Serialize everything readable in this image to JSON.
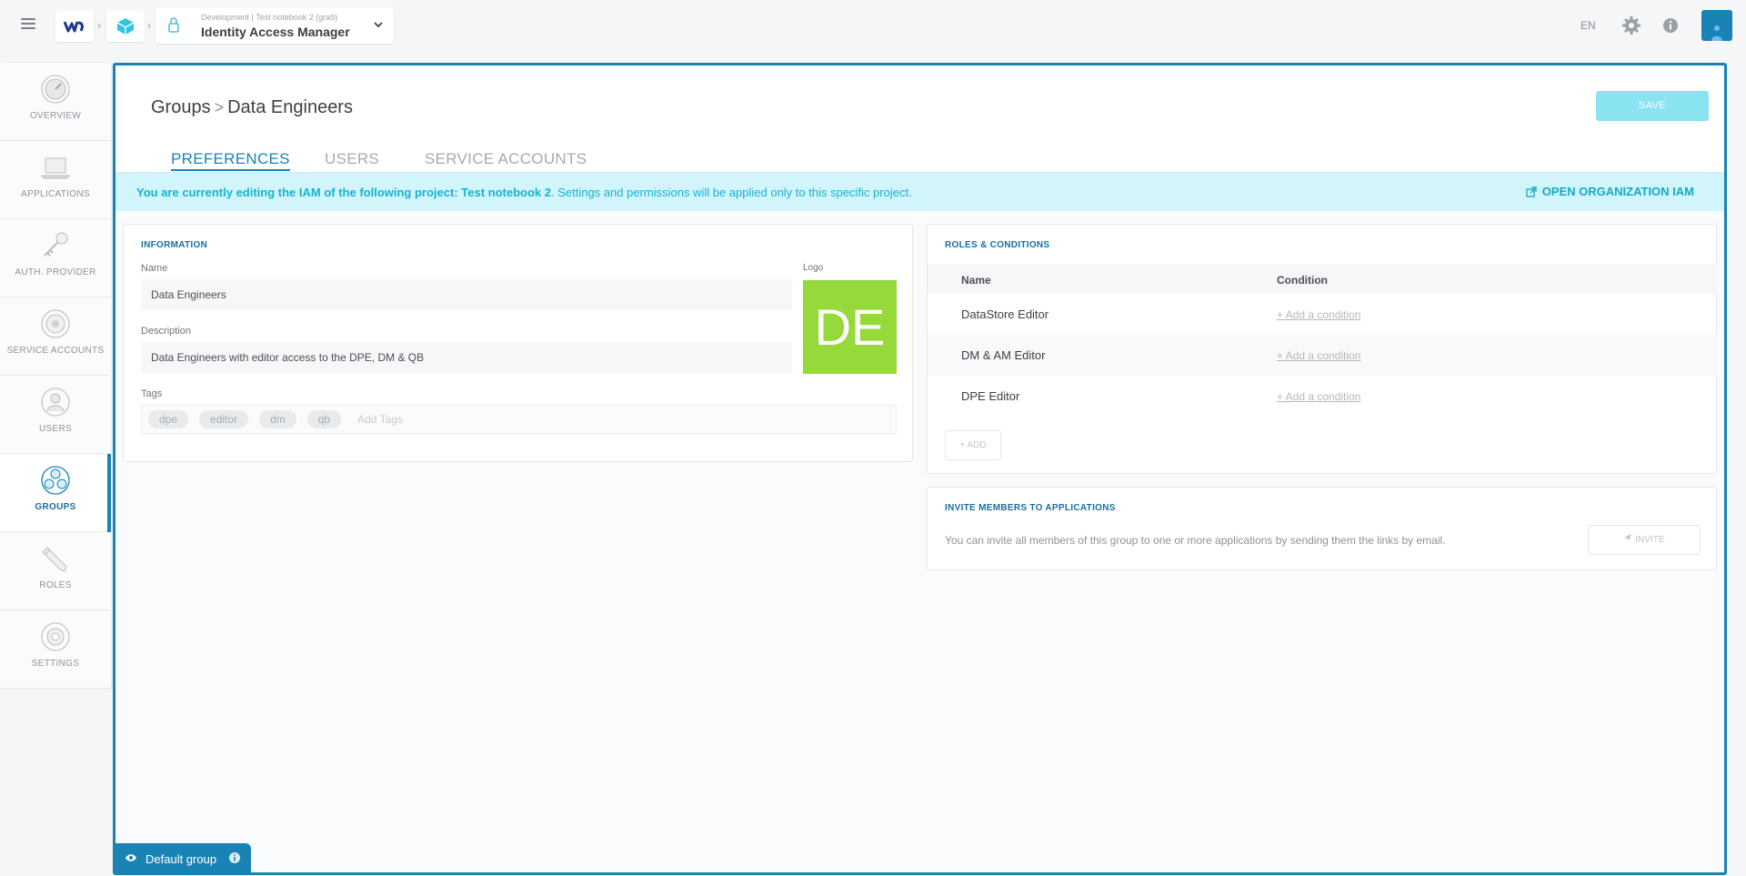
{
  "topbar": {
    "context": "Development | Test notebook 2 (gra9)",
    "app_name": "Identity Access Manager",
    "language": "EN"
  },
  "sidebar": {
    "items": [
      {
        "label": "OVERVIEW",
        "icon": "overview-icon"
      },
      {
        "label": "APPLICATIONS",
        "icon": "laptop-icon"
      },
      {
        "label": "AUTH. PROVIDER",
        "icon": "key-icon"
      },
      {
        "label": "SERVICE ACCOUNTS",
        "icon": "service-accounts-icon"
      },
      {
        "label": "USERS",
        "icon": "user-icon"
      },
      {
        "label": "GROUPS",
        "icon": "groups-icon",
        "active": true
      },
      {
        "label": "ROLES",
        "icon": "pencil-icon"
      },
      {
        "label": "SETTINGS",
        "icon": "gear-icon"
      }
    ]
  },
  "page": {
    "breadcrumb_parent": "Groups",
    "breadcrumb_current": "Data Engineers",
    "save_label": "SAVE",
    "tabs": [
      {
        "label": "PREFERENCES",
        "active": true
      },
      {
        "label": "USERS"
      },
      {
        "label": "SERVICE ACCOUNTS"
      }
    ]
  },
  "banner": {
    "prefix": "You are currently editing the IAM of the following project: Test notebook 2",
    "suffix": ". Settings and permissions will be applied only to this specific project.",
    "link_label": "OPEN ORGANIZATION IAM"
  },
  "information": {
    "title": "INFORMATION",
    "name_label": "Name",
    "name_value": "Data Engineers",
    "description_label": "Description",
    "description_value": "Data Engineers with editor access to the DPE, DM & QB",
    "logo_label": "Logo",
    "logo_text": "DE",
    "tags_label": "Tags",
    "tags": [
      "dpe",
      "editor",
      "dm",
      "qb"
    ],
    "tags_placeholder": "Add Tags"
  },
  "roles": {
    "title": "ROLES & CONDITIONS",
    "col_name": "Name",
    "col_condition": "Condition",
    "rows": [
      {
        "name": "DataStore Editor",
        "condition": "+ Add a condition"
      },
      {
        "name": "DM & AM Editor",
        "condition": "+ Add a condition"
      },
      {
        "name": "DPE Editor",
        "condition": "+ Add a condition"
      }
    ],
    "add_label": "ADD"
  },
  "invite": {
    "title": "INVITE MEMBERS TO APPLICATIONS",
    "text": "You can invite all members of this group to one or more applications by sending them the links by email.",
    "button_label": "INVITE"
  },
  "footer": {
    "default_group_label": "Default group"
  },
  "colors": {
    "primary": "#1a83b5",
    "accent": "#12b4d0",
    "logo_bg": "#96d93a",
    "banner_bg": "#d2f5fb"
  }
}
